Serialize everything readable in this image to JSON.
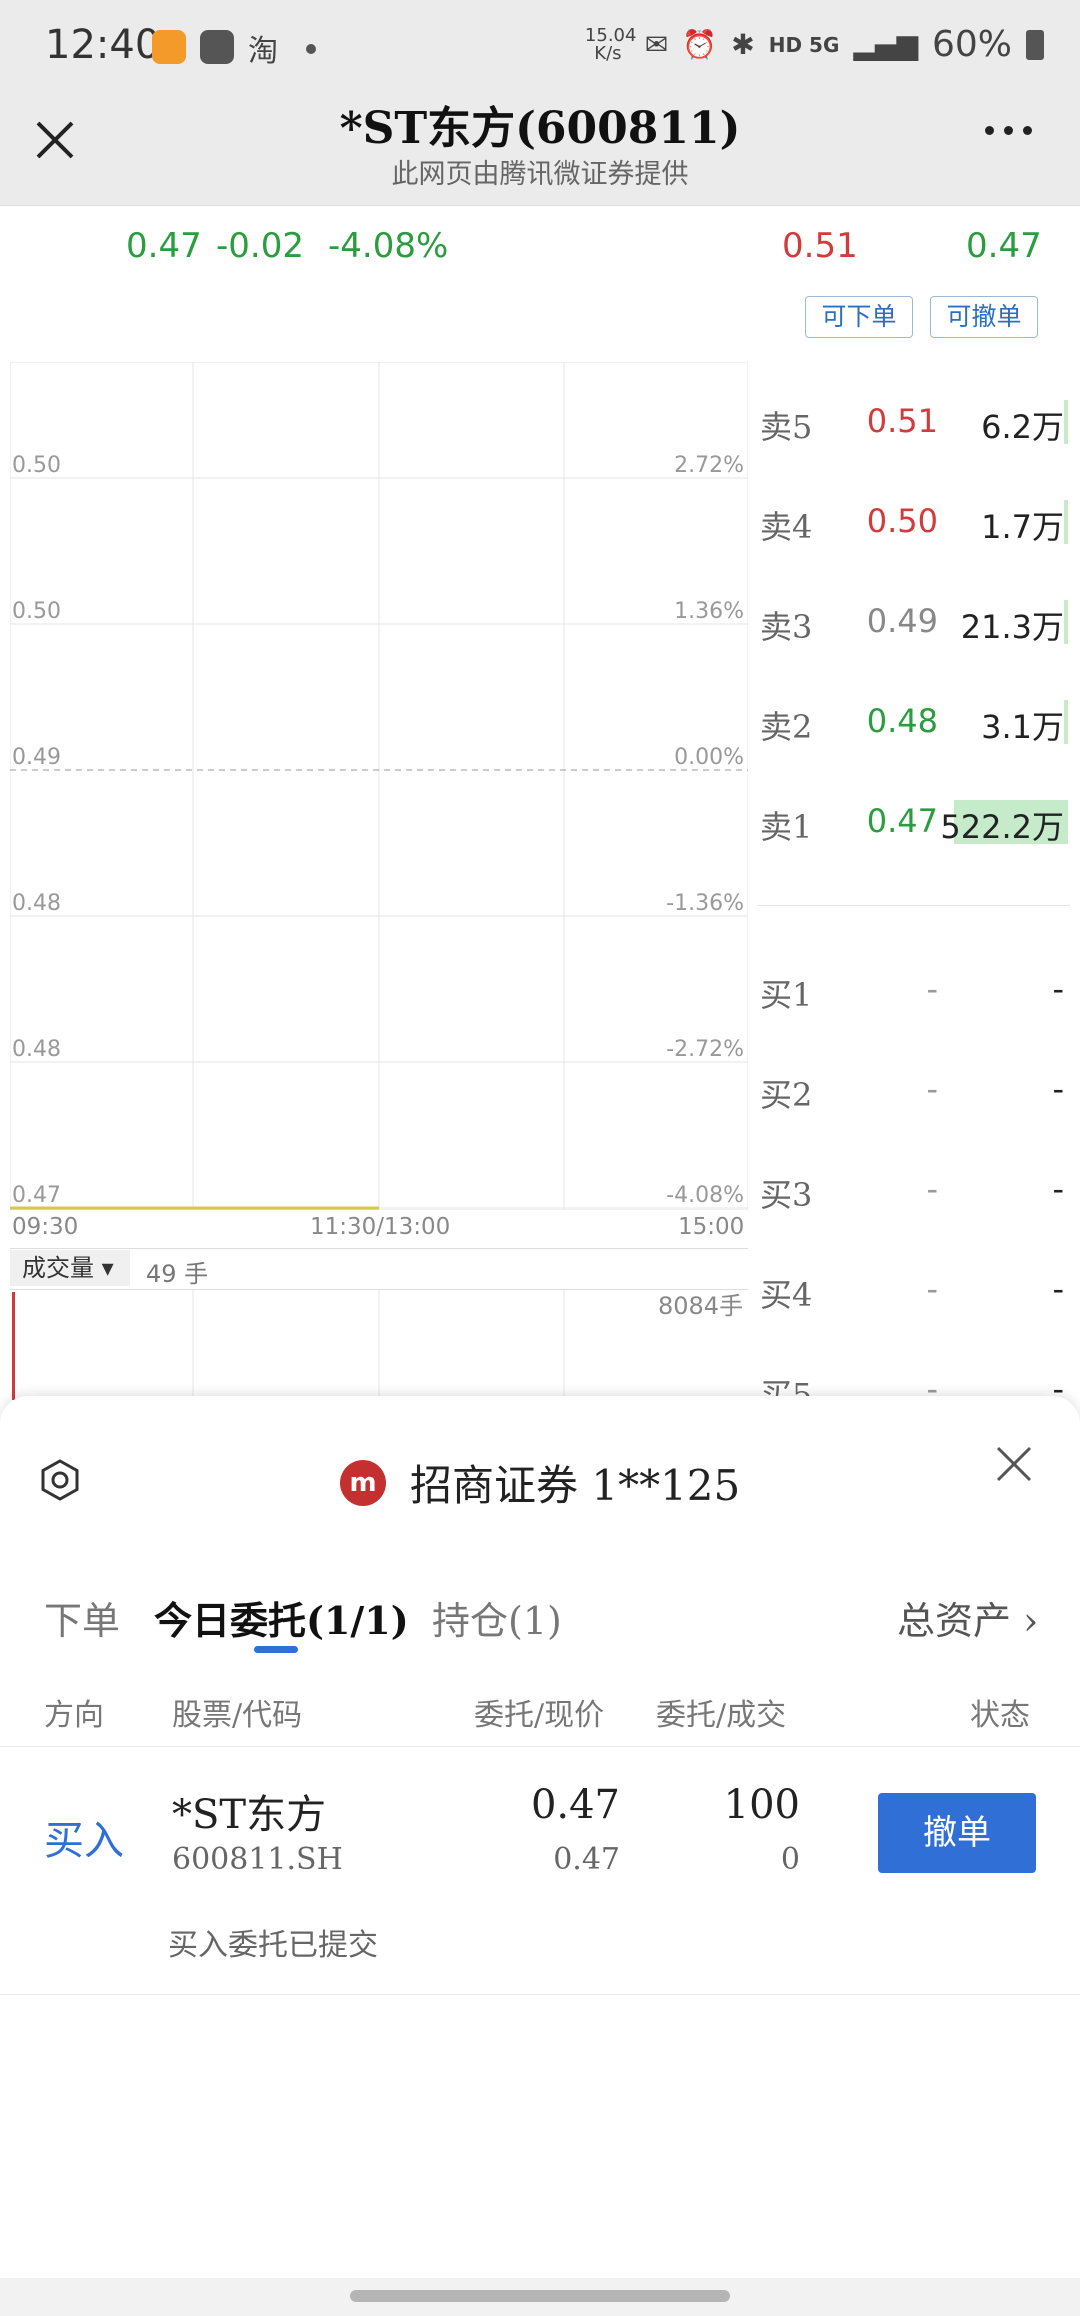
{
  "status_bar": {
    "time": "12:40",
    "net_speed": "15.04 K/s",
    "network": "HD 5G",
    "battery": "60%"
  },
  "title_bar": {
    "title": "*ST东方(600811)",
    "subtitle": "此网页由腾讯微证券提供"
  },
  "quote": {
    "price": "0.47",
    "change": "-0.02",
    "change_pct": "-4.08%",
    "high": "0.51",
    "low": "0.47",
    "can_order_label": "可下单",
    "can_cancel_label": "可撤单"
  },
  "chart_data": {
    "type": "line",
    "title": "",
    "x_ticks": [
      "09:30",
      "11:30/13:00",
      "15:00"
    ],
    "y_left_ticks": [
      "0.50",
      "0.50",
      "0.49",
      "0.48",
      "0.48",
      "0.47"
    ],
    "y_right_ticks": [
      "2.72%",
      "1.36%",
      "0.00%",
      "-1.36%",
      "-2.72%",
      "-4.08%"
    ],
    "reference_price": 0.49,
    "series": [
      {
        "values": [
          0.47,
          0.47,
          0.47,
          0.47,
          0.47,
          0.47
        ]
      }
    ],
    "ylim": [
      0.47,
      0.5
    ],
    "grid": true
  },
  "volume": {
    "label": "成交量",
    "value": "49 手",
    "max_label": "8084手"
  },
  "order_book": {
    "asks": [
      {
        "label": "卖5",
        "price": "0.51",
        "vol": "6.2万",
        "color": "#d23b3b",
        "bar": 0.01
      },
      {
        "label": "卖4",
        "price": "0.50",
        "vol": "1.7万",
        "color": "#d23b3b",
        "bar": 0.01
      },
      {
        "label": "卖3",
        "price": "0.49",
        "vol": "21.3万",
        "color": "#888888",
        "bar": 0.04
      },
      {
        "label": "卖2",
        "price": "0.48",
        "vol": "3.1万",
        "color": "#2a9d3f",
        "bar": 0.01
      },
      {
        "label": "卖1",
        "price": "0.47",
        "vol": "522.2万",
        "color": "#2a9d3f",
        "bar": 1.0
      }
    ],
    "bids": [
      {
        "label": "买1",
        "price": "-",
        "vol": "-"
      },
      {
        "label": "买2",
        "price": "-",
        "vol": "-"
      },
      {
        "label": "买3",
        "price": "-",
        "vol": "-"
      },
      {
        "label": "买4",
        "price": "-",
        "vol": "-"
      },
      {
        "label": "买5",
        "price": "-",
        "vol": "-"
      }
    ]
  },
  "sheet": {
    "broker_logo": "m",
    "broker": "招商证券 1**125",
    "tabs": {
      "order": "下单",
      "today": "今日委托(1/1)",
      "position": "持仓(1)",
      "assets": "总资产 ›"
    },
    "headers": {
      "direction": "方向",
      "stock": "股票/代码",
      "price": "委托/现价",
      "qty": "委托/成交",
      "status": "状态"
    },
    "row": {
      "direction": "买入",
      "name": "*ST东方",
      "code": "600811.SH",
      "order_price": "0.47",
      "current_price": "0.47",
      "order_qty": "100",
      "filled_qty": "0",
      "cancel_label": "撤单",
      "note": "买入委托已提交"
    }
  },
  "colors": {
    "accent": "#2f6fd6",
    "up": "#d23b3b",
    "down": "#2a9d3f",
    "price_line": "#d9c74a"
  }
}
